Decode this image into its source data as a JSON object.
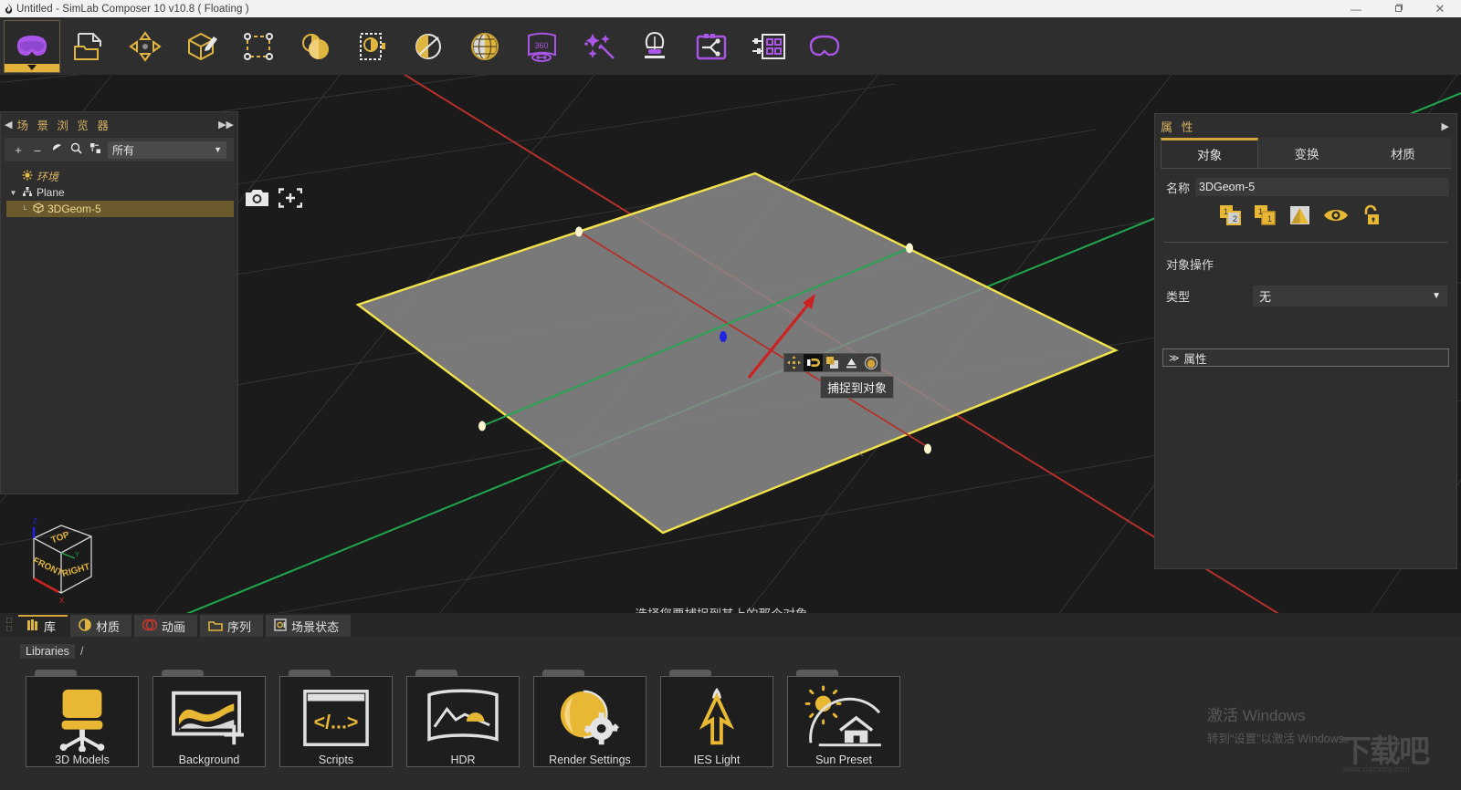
{
  "window": {
    "title": "Untitled - SimLab Composer 10 v10.8 ( Floating )",
    "app_icon": "simlab-flame-icon",
    "minimize": "—",
    "maximize": "❐",
    "close": "✕"
  },
  "main_toolbar": {
    "buttons": [
      {
        "name": "vr-viewer",
        "icon": "vr-headset-icon",
        "active": true
      },
      {
        "name": "open-file",
        "icon": "open-folder-icon",
        "active": false
      },
      {
        "name": "move-transform",
        "icon": "four-arrows-move-icon",
        "active": false
      },
      {
        "name": "edit-geometry",
        "icon": "box-pencil-icon",
        "active": false
      },
      {
        "name": "selection-box",
        "icon": "dashed-rectangle-icon",
        "active": false
      },
      {
        "name": "materials",
        "icon": "two-spheres-icon",
        "active": false
      },
      {
        "name": "texture-page",
        "icon": "sphere-page-icon",
        "active": false
      },
      {
        "name": "render-sphere",
        "icon": "sphere-slash-icon",
        "active": false
      },
      {
        "name": "globe-environment",
        "icon": "globe-icon",
        "active": false
      },
      {
        "name": "panorama-360",
        "icon": "panorama-360-icon",
        "active": false
      },
      {
        "name": "magic-effects",
        "icon": "magic-wand-icon",
        "active": false
      },
      {
        "name": "lighting",
        "icon": "lamp-icon",
        "active": false
      },
      {
        "name": "automation",
        "icon": "flow-node-icon",
        "active": false
      },
      {
        "name": "grid-layout",
        "icon": "grid-panels-icon",
        "active": false
      },
      {
        "name": "vr-preview",
        "icon": "vr-goggles-icon",
        "active": false
      }
    ],
    "panorama_label": "360"
  },
  "scene_browser": {
    "title": "场 景 浏 览 器",
    "collapse_icon": "◀",
    "expand_icon": "▶▶",
    "toolbar_icons": [
      "add-icon",
      "remove-icon",
      "visibility-icon",
      "search-icon",
      "refresh-icon"
    ],
    "filter_value": "所有",
    "filter_caret": "▼",
    "tree": [
      {
        "label": "环境",
        "icon": "sun-environment-icon",
        "depth": 0,
        "twisty": "",
        "selected": false
      },
      {
        "label": "Plane",
        "icon": "hierarchy-icon",
        "depth": 0,
        "twisty": "▼",
        "selected": false
      },
      {
        "label": "3DGeom-5",
        "icon": "geometry-icon",
        "depth": 1,
        "twisty": "└",
        "selected": true
      }
    ]
  },
  "snapshot_tools": [
    {
      "name": "camera-snapshot",
      "icon": "camera-icon"
    },
    {
      "name": "add-view",
      "icon": "frame-plus-icon"
    }
  ],
  "viewport": {
    "hint_text": "选择您要捕捉到其上的那个对象",
    "grip": "......",
    "object_color": "#8a8a8a",
    "selection_color": "#f2e34a",
    "axis_x_color": "#c0392b",
    "axis_y_color": "#27ae60",
    "pivot_color": "#2222dd",
    "arrow_color": "#cc2222",
    "nav_cube": {
      "top": "TOP",
      "front": "FRONT",
      "right": "RIGHT",
      "axis_x": "X",
      "axis_z": "Z",
      "axis_y": "Y"
    },
    "snap_toolbar": {
      "tooltip": "捕捉到对象",
      "buttons": [
        {
          "name": "snap-move",
          "icon": "four-arrows-icon",
          "active": false
        },
        {
          "name": "snap-to-object",
          "icon": "magnet-snap-icon",
          "active": true
        },
        {
          "name": "snap-to-face",
          "icon": "stacked-faces-icon",
          "active": false
        },
        {
          "name": "snap-to-ground",
          "icon": "ground-plane-icon",
          "active": false
        },
        {
          "name": "snap-rotate",
          "icon": "rotate-ball-icon",
          "active": false
        }
      ]
    },
    "bottom_tools": [
      {
        "name": "select-object-mode",
        "icon": "cube-cursor-icon",
        "caret": true
      },
      {
        "name": "selection-frame-mode",
        "icon": "frame-mesh-icon",
        "caret": true
      },
      {
        "name": "display-mode",
        "icon": "solid-cube-icon",
        "caret": true
      },
      {
        "name": "pointer-tool",
        "icon": "arrow-pointer-icon",
        "caret": true
      },
      {
        "name": "mesh-tool",
        "icon": "mesh-icon",
        "caret": false
      },
      {
        "name": "zoom-tool",
        "icon": "magnifier-icon",
        "caret": false
      },
      {
        "name": "shade-tool",
        "icon": "diamond-mesh-icon",
        "caret": false
      },
      {
        "name": "grid-toggle",
        "icon": "grid-icon",
        "caret": false
      },
      {
        "name": "drop-to-floor",
        "icon": "arrow-down-bar-icon",
        "caret": false
      }
    ]
  },
  "properties": {
    "title": "属 性",
    "expand_icon": "▶",
    "tabs": [
      {
        "label": "对象",
        "active": true
      },
      {
        "label": "变换",
        "active": false
      },
      {
        "label": "材质",
        "active": false
      }
    ],
    "name_label": "名称",
    "name_value": "3DGeom-5",
    "object_icons": [
      {
        "name": "copy-instance-icon",
        "badge": "1/2"
      },
      {
        "name": "duplicate-icon",
        "badge": "1/1"
      },
      {
        "name": "shading-smooth-icon",
        "badge": ""
      },
      {
        "name": "visibility-eye-icon",
        "badge": ""
      },
      {
        "name": "unlock-icon",
        "badge": ""
      }
    ],
    "object_ops_label": "对象操作",
    "type_label": "类型",
    "type_value": "无",
    "type_caret": "▼",
    "attributes_label": "属性",
    "attributes_caret": "≫"
  },
  "bottom_tabs": {
    "corner_icons": [
      "collapse-icon",
      "expand-icon"
    ],
    "tabs": [
      {
        "label": "库",
        "icon": "books-icon",
        "active": true
      },
      {
        "label": "材质",
        "icon": "material-sphere-icon",
        "active": false
      },
      {
        "label": "动画",
        "icon": "animation-icon",
        "active": false
      },
      {
        "label": "序列",
        "icon": "sequence-folder-icon",
        "active": false
      },
      {
        "label": "场景状态",
        "icon": "scene-state-icon",
        "active": false
      }
    ]
  },
  "library": {
    "breadcrumb_root": "Libraries",
    "breadcrumb_sep": "/",
    "items": [
      {
        "label": "3D Models",
        "icon": "office-chair-icon"
      },
      {
        "label": "Background",
        "icon": "background-image-icon"
      },
      {
        "label": "Scripts",
        "icon": "code-window-icon"
      },
      {
        "label": "HDR",
        "icon": "hdr-panorama-icon"
      },
      {
        "label": "Render Settings",
        "icon": "sphere-gear-icon"
      },
      {
        "label": "IES Light",
        "icon": "ies-light-icon"
      },
      {
        "label": "Sun Preset",
        "icon": "sun-house-icon"
      }
    ]
  },
  "watermark": {
    "line1": "激活 Windows",
    "line2": "转到“设置”以激活 Windows。",
    "logo": "下载吧",
    "logo_sub": "www.xiazaiba.com"
  }
}
